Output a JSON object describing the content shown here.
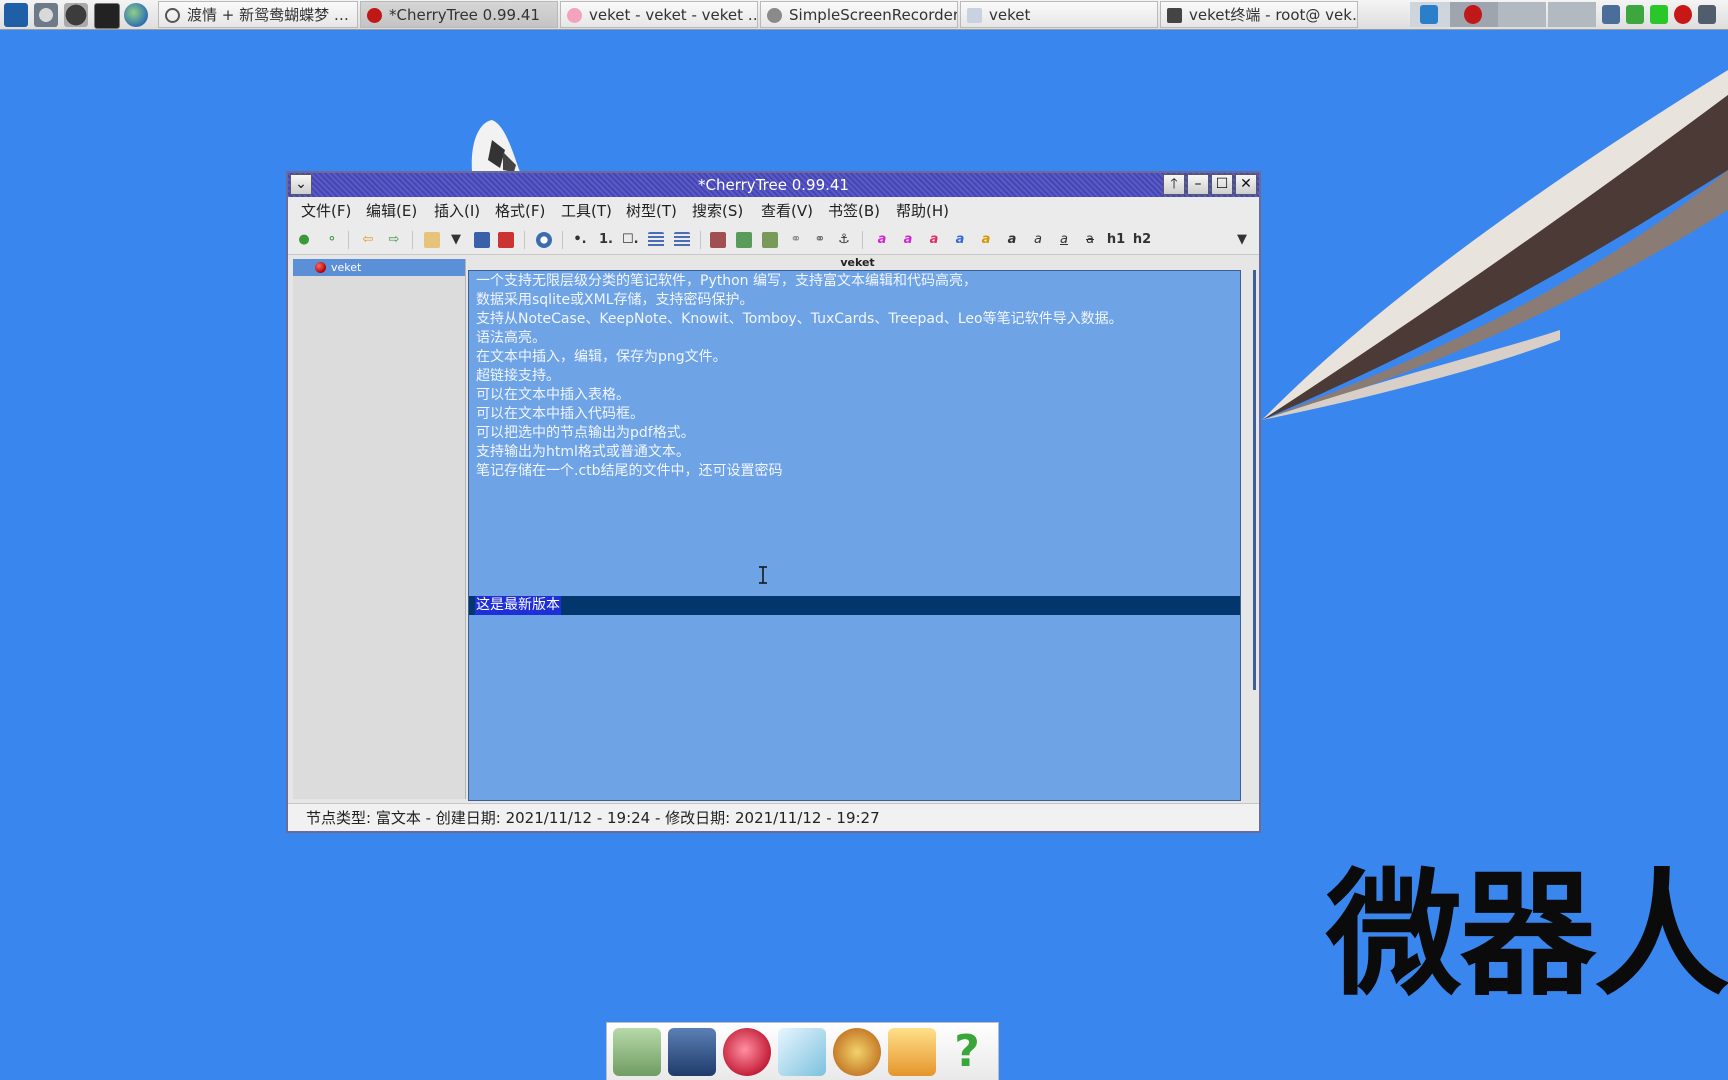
{
  "taskbar": {
    "tasks": [
      {
        "label": "渡情 + 新鸳鸯蝴蝶梦 …",
        "icon": "record-icon"
      },
      {
        "label": "*CherryTree 0.99.41",
        "icon": "cherry-icon"
      },
      {
        "label": "veket - veket - veket …",
        "icon": "browser-icon"
      },
      {
        "label": "SimpleScreenRecorder",
        "icon": "recorder-icon"
      },
      {
        "label": "veket",
        "icon": "folder-icon"
      },
      {
        "label": "veket终端 - root@ vek…",
        "icon": "terminal-icon"
      }
    ],
    "launchers": [
      "system-monitor-icon",
      "settings-icon",
      "play-icon",
      "terminal-icon",
      "globe-icon"
    ],
    "tray": [
      "network-icon",
      "shield-icon",
      "battery-icon",
      "record-icon",
      "keyboard-icon"
    ]
  },
  "window": {
    "title": "*CherryTree 0.99.41",
    "menus": [
      "文件(F)",
      "编辑(E)",
      "插入(I)",
      "格式(F)",
      "工具(T)",
      "树型(T)",
      "搜索(S)",
      "查看(V)",
      "书签(B)",
      "帮助(H)"
    ],
    "toolbar": {
      "h1_label": "h1",
      "h2_label": "h2",
      "bullet_label": "•.",
      "number_label": "1.",
      "todo_label": "☐."
    },
    "tree": {
      "nodes": [
        {
          "label": "veket",
          "selected": true
        }
      ]
    },
    "node_header": "veket",
    "editor": {
      "lines": [
        "一个支持无限层级分类的笔记软件，Python 编写，支持富文本编辑和代码高亮，",
        "数据采用sqlite或XML存储，支持密码保护。",
        "支持从NoteCase、KeepNote、Knowit、Tomboy、TuxCards、Treepad、Leo等笔记软件导入数据。",
        "语法高亮。",
        "在文本中插入，编辑，保存为png文件。",
        "超链接支持。",
        "可以在文本中插入表格。",
        "可以在文本中插入代码框。",
        "可以把选中的节点输出为pdf格式。",
        "支持输出为html格式或普通文本。",
        "笔记存储在一个.ctb结尾的文件中，还可设置密码"
      ],
      "highlighted_line": "这是最新版本"
    },
    "status": "节点类型: 富文本  -  创建日期: 2021/11/12 - 19:24  -  修改日期: 2021/11/12 - 19:27"
  },
  "desktop": {
    "watermark": "微器人"
  },
  "dock": {
    "items": [
      "file-manager-icon",
      "computer-icon",
      "mascot-icon",
      "text-editor-icon",
      "paint-icon",
      "veket-icon",
      "help-icon"
    ]
  },
  "colors": {
    "desktop": "#3a86ef",
    "titlebar": "#4f4fbf",
    "editor_bg": "#6ea3e6",
    "selection": "#03366c",
    "text_selection": "#1f2fd6"
  }
}
